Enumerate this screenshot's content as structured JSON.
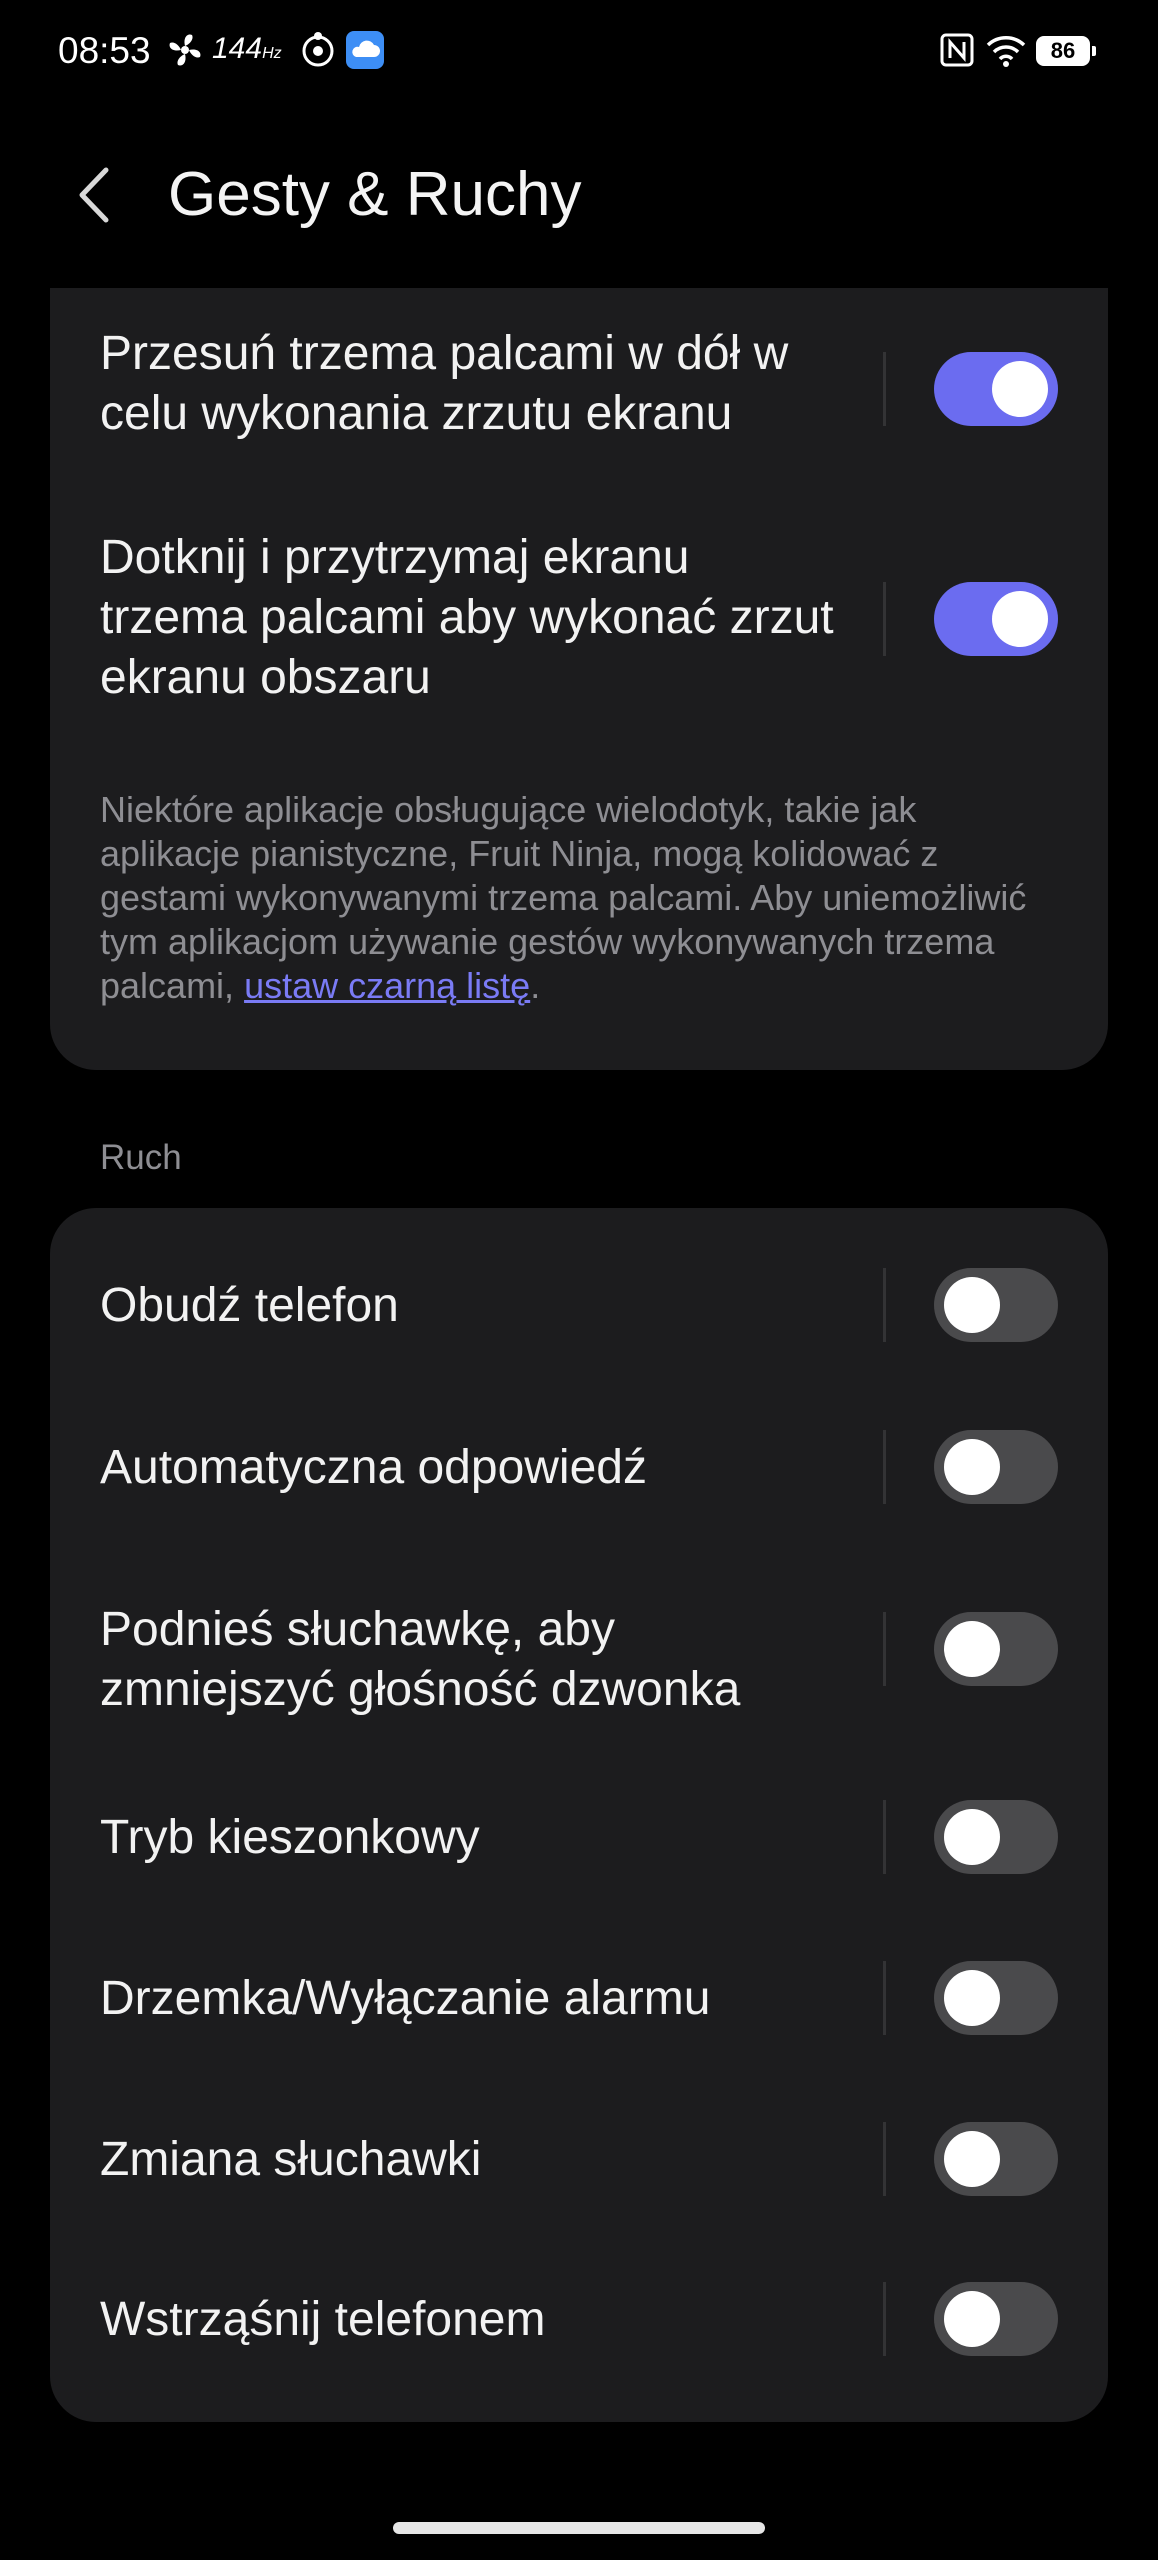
{
  "status_bar": {
    "time": "08:53",
    "refresh_rate": "144",
    "refresh_unit": "Hz",
    "battery": "86"
  },
  "header": {
    "title": "Gesty & Ruchy"
  },
  "gestures": {
    "items": [
      {
        "label": "Przesuń trzema palcami w dół w celu wykonania zrzutu ekranu",
        "enabled": true
      },
      {
        "label": "Dotknij i przytrzymaj ekranu trzema palcami aby wykonać zrzut ekranu obszaru",
        "enabled": true
      }
    ],
    "note_text": "Niektóre aplikacje obsługujące wielodotyk, takie jak aplikacje pianistyczne, Fruit Ninja, mogą kolidować z gestami wykonywanymi trzema palcami. Aby uniemożliwić tym aplikacjom używanie gestów wykonywanych trzema palcami, ",
    "note_link": "ustaw czarną listę",
    "note_end": "."
  },
  "motion": {
    "section_title": "Ruch",
    "items": [
      {
        "label": "Obudź telefon",
        "enabled": false
      },
      {
        "label": "Automatyczna odpowiedź",
        "enabled": false
      },
      {
        "label": "Podnieś słuchawkę, aby zmniejszyć głośność dzwonka",
        "enabled": false
      },
      {
        "label": "Tryb kieszonkowy",
        "enabled": false
      },
      {
        "label": "Drzemka/Wyłączanie alarmu",
        "enabled": false
      },
      {
        "label": "Zmiana słuchawki",
        "enabled": false
      },
      {
        "label": "Wstrząśnij telefonem",
        "enabled": false
      }
    ]
  },
  "colors": {
    "accent": "#6b6cf0",
    "card": "#1c1c1e",
    "background": "#000000"
  }
}
